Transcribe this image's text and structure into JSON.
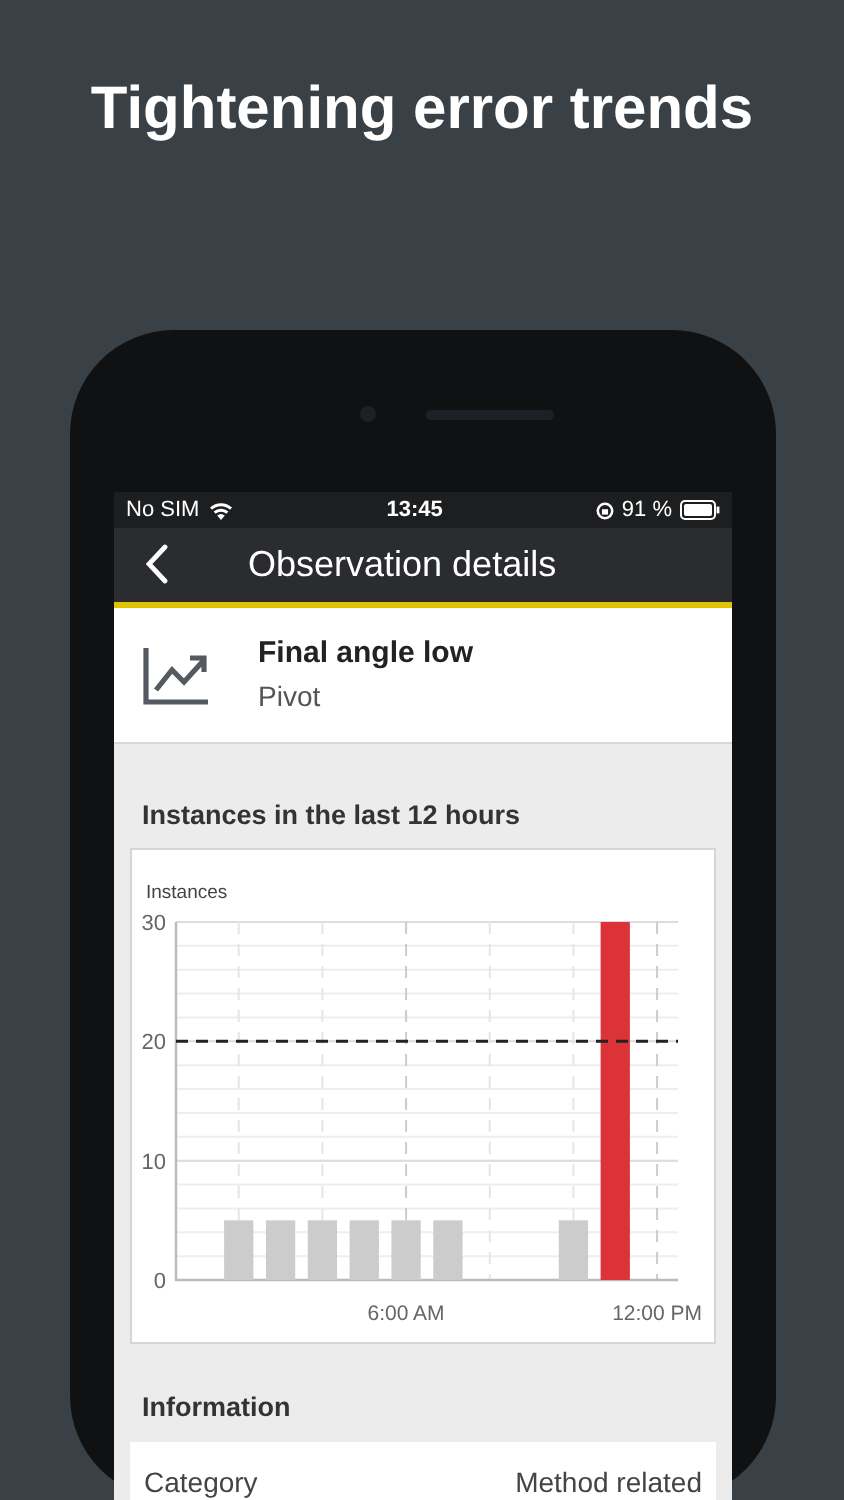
{
  "headline": "Tightening error trends",
  "status_bar": {
    "carrier": "No SIM",
    "time": "13:45",
    "battery": "91 %"
  },
  "nav": {
    "title": "Observation details"
  },
  "observation": {
    "title": "Final angle low",
    "subtitle": "Pivot"
  },
  "chart_section": {
    "title": "Instances in the last 12 hours",
    "chart_data": {
      "type": "bar",
      "ylabel": "Instances",
      "x": [
        2,
        3,
        4,
        5,
        6,
        7,
        10,
        11
      ],
      "values": [
        5,
        5,
        5,
        5,
        5,
        5,
        5,
        30
      ],
      "grid": true,
      "xlim": [
        0.5,
        12.5
      ],
      "ylim": [
        0,
        30
      ],
      "yticks": [
        0,
        10,
        20,
        30
      ],
      "xticks": [
        {
          "value": 6,
          "label": "6:00 AM"
        },
        {
          "value": 12,
          "label": "12:00 PM"
        }
      ],
      "ref_lines": [
        {
          "axis": "y",
          "value": 20
        }
      ]
    }
  },
  "information": {
    "title": "Information",
    "rows": [
      {
        "label": "Category",
        "value": "Method related"
      }
    ]
  }
}
